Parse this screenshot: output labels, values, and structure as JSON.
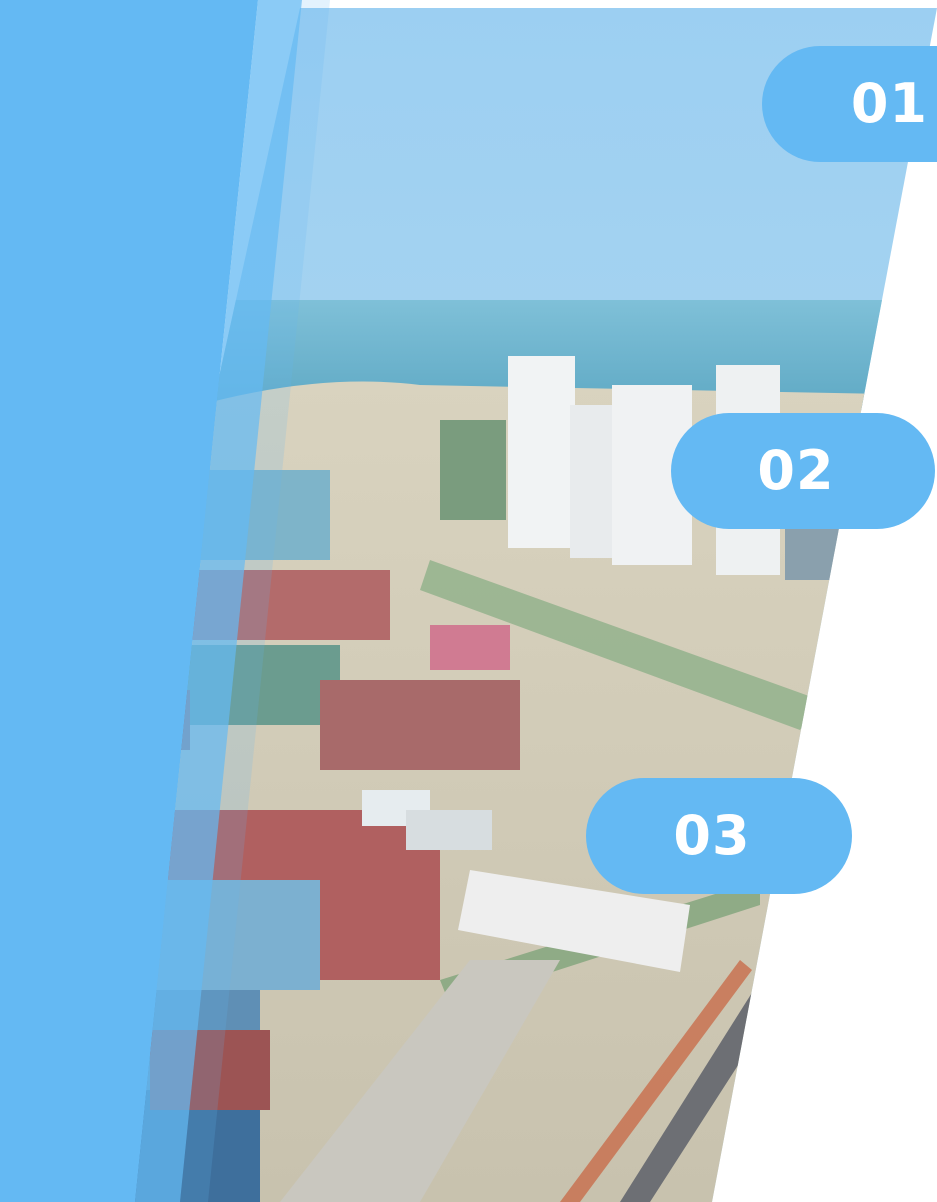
{
  "slide": {
    "accent_color": "#64b9f3",
    "photo_subject": "aerial-port-container-yard",
    "steps": [
      {
        "number": "01"
      },
      {
        "number": "02"
      },
      {
        "number": "03"
      }
    ]
  }
}
